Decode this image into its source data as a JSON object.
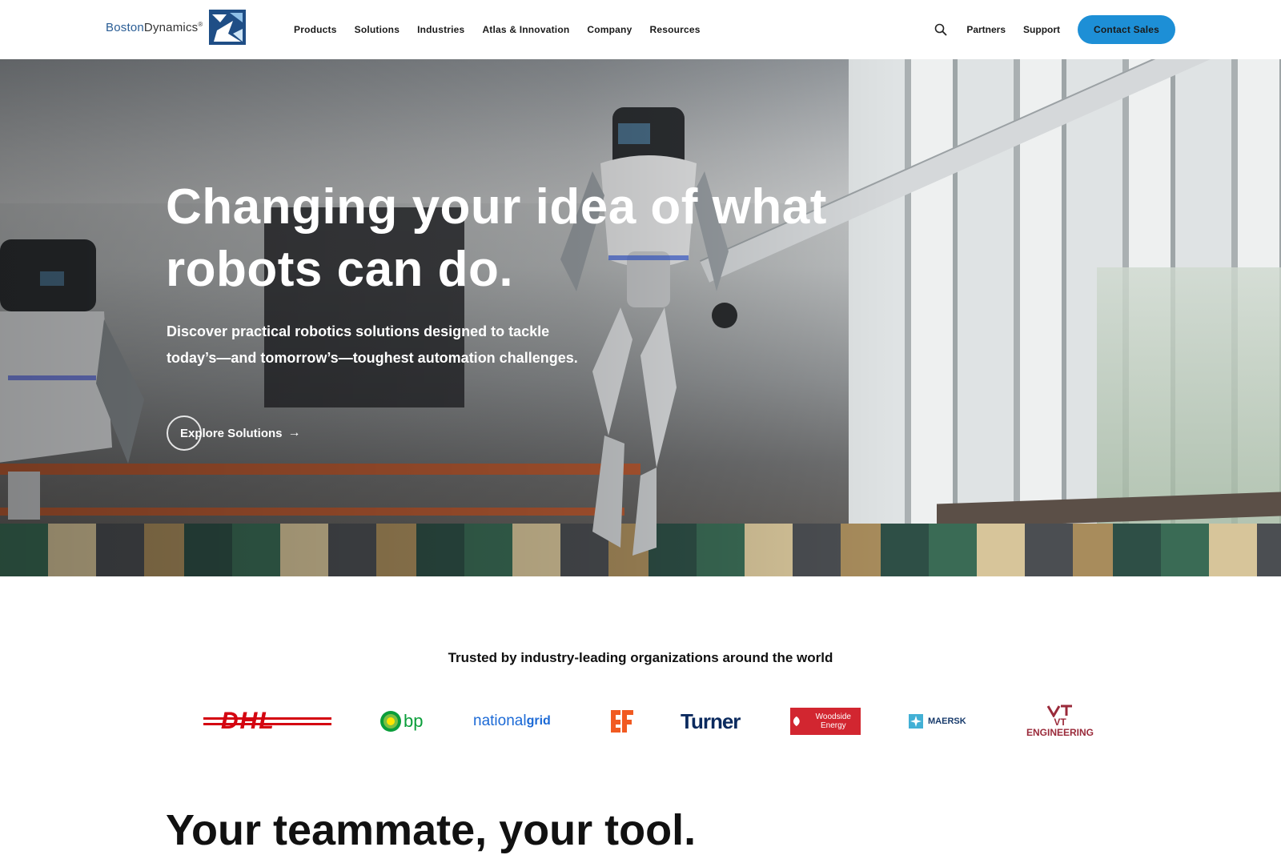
{
  "header": {
    "logo_text_blue": "Boston",
    "logo_text_gray": "Dynamics",
    "logo_mark": "®",
    "nav": [
      "Products",
      "Solutions",
      "Industries",
      "Atlas & Innovation",
      "Company",
      "Resources"
    ],
    "search_icon": "search-icon",
    "links": [
      "Partners",
      "Support"
    ],
    "cta": "Contact Sales"
  },
  "hero": {
    "headline": "Changing your idea of what robots can do.",
    "subtext": "Discover practical robotics solutions designed to tackle today’s—and tomorrow’s—toughest automation challenges.",
    "button_label": "Explore Solutions",
    "button_arrow": "→"
  },
  "trusted": {
    "heading": "Trusted by industry-leading organizations around the world",
    "logos": [
      {
        "name": "DHL",
        "text": "DHL"
      },
      {
        "name": "bp",
        "text": "bp"
      },
      {
        "name": "National Grid",
        "text_light": "national",
        "text_bold": "grid"
      },
      {
        "name": "GF",
        "text": ""
      },
      {
        "name": "Turner",
        "text": "Turner"
      },
      {
        "name": "Woodside Energy",
        "text": "Woodside Energy"
      },
      {
        "name": "Maersk",
        "text": "MAERSK"
      },
      {
        "name": "VT Engineering",
        "text": "VT ENGINEERING"
      }
    ]
  },
  "section": {
    "title": "Your teammate, your tool."
  },
  "colors": {
    "accent": "#1d8fd6",
    "dhl_red": "#d40511",
    "bp_green": "#0a9e3a",
    "nationalgrid_blue": "#1c6ad6",
    "gf_orange": "#f15a22",
    "turner_navy": "#0b2a5e",
    "woodside_red": "#d22630",
    "maersk_blue": "#42b0d5",
    "vt_maroon": "#9a2a3a"
  }
}
